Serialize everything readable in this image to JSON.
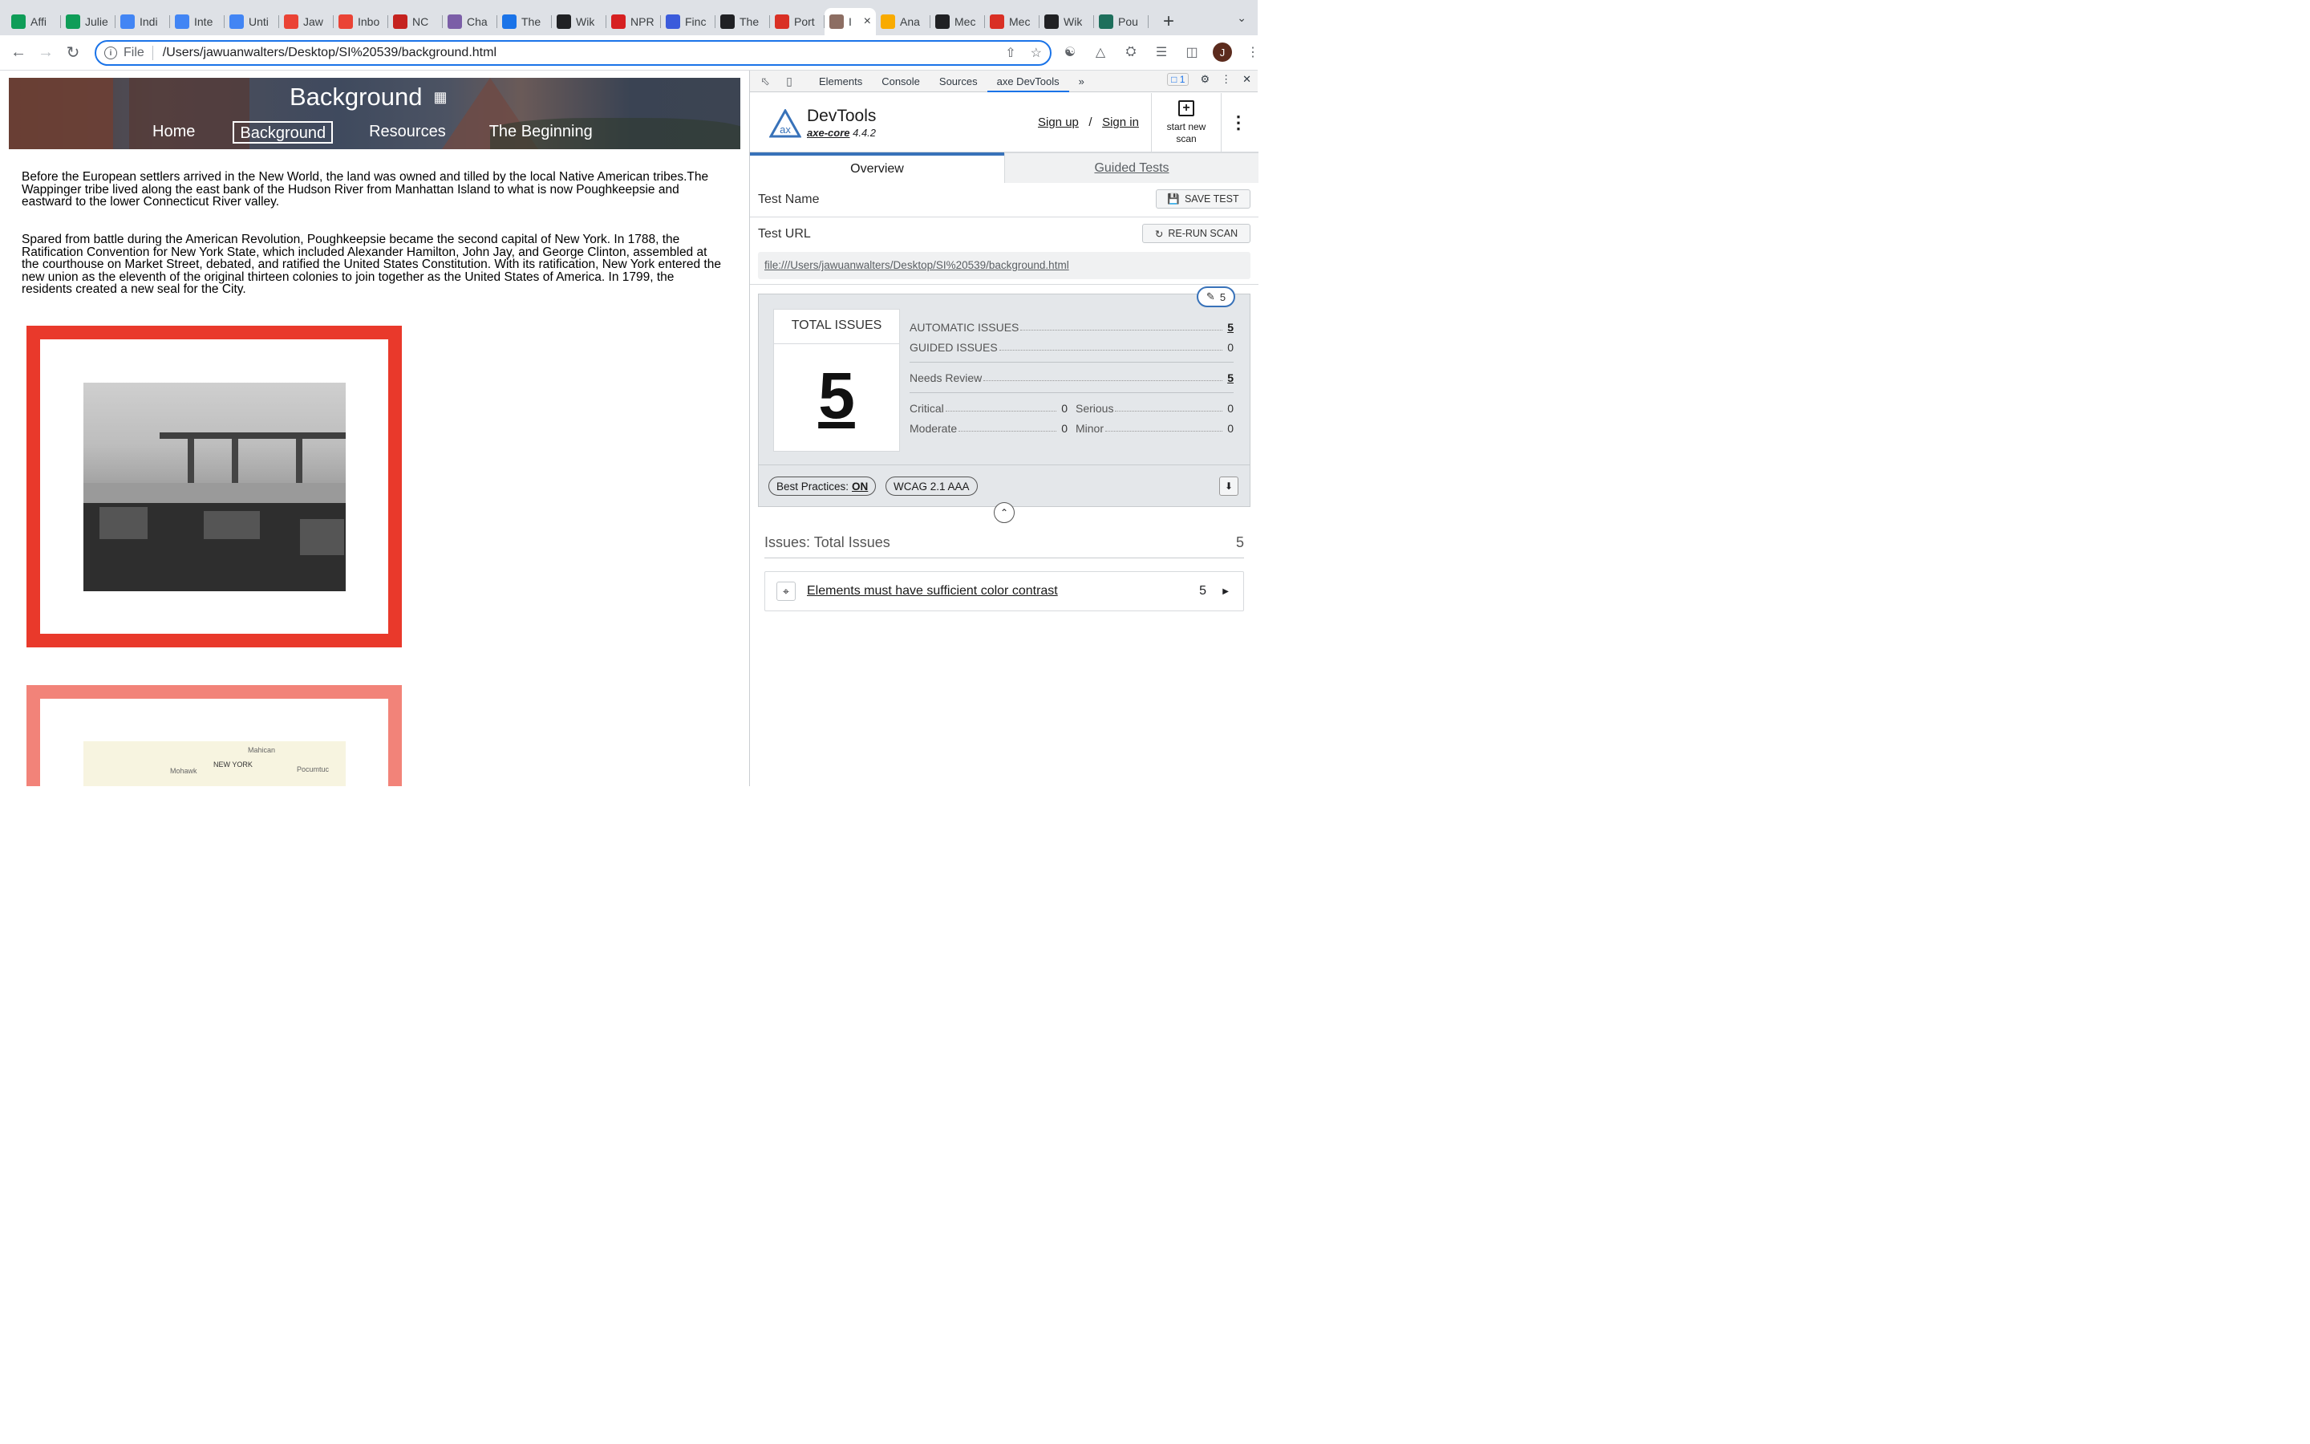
{
  "browser": {
    "tabs": [
      {
        "title": "Affi",
        "icon": "drive-icon",
        "color": "#0f9d58"
      },
      {
        "title": "Julie",
        "icon": "sheets-icon",
        "color": "#0f9d58"
      },
      {
        "title": "Indi",
        "icon": "docs-icon",
        "color": "#4285f4"
      },
      {
        "title": "Inte",
        "icon": "docs-icon",
        "color": "#4285f4"
      },
      {
        "title": "Unti",
        "icon": "docs-icon",
        "color": "#4285f4"
      },
      {
        "title": "Jaw",
        "icon": "gmail-icon",
        "color": "#ea4335"
      },
      {
        "title": "Inbo",
        "icon": "gmail-icon",
        "color": "#ea4335"
      },
      {
        "title": "NC",
        "icon": "nc-icon",
        "color": "#c5221f"
      },
      {
        "title": "Cha",
        "icon": "chart-icon",
        "color": "#7b5ea7"
      },
      {
        "title": "The",
        "icon": "hook-icon",
        "color": "#1a73e8"
      },
      {
        "title": "Wik",
        "icon": "wikipedia-icon",
        "color": "#202124"
      },
      {
        "title": "NPR",
        "icon": "npr-icon",
        "color": "#d62021"
      },
      {
        "title": "Finc",
        "icon": "find-icon",
        "color": "#3b5bdb"
      },
      {
        "title": "The",
        "icon": "nyt-icon",
        "color": "#202124"
      },
      {
        "title": "Port",
        "icon": "portal-icon",
        "color": "#d93025"
      },
      {
        "title": "I",
        "icon": "page-thumb-icon",
        "color": "#8d6e63",
        "active": true
      },
      {
        "title": "Ana",
        "icon": "analytics-icon",
        "color": "#f9ab00"
      },
      {
        "title": "Mec",
        "icon": "mec-icon",
        "color": "#202124"
      },
      {
        "title": "Mec",
        "icon": "asterisk-icon",
        "color": "#d93025"
      },
      {
        "title": "Wik",
        "icon": "wikipedia-icon",
        "color": "#202124"
      },
      {
        "title": "Pou",
        "icon": "lp-icon",
        "color": "#1e6f5c"
      }
    ],
    "new_tab": "+",
    "address": {
      "scheme_label": "File",
      "url": "/Users/jawuanwalters/Desktop/SI%20539/background.html"
    },
    "avatar_letter": "J"
  },
  "page": {
    "header_title": "Background",
    "nav": [
      "Home",
      "Background",
      "Resources",
      "The Beginning"
    ],
    "paragraph1": "Before the European settlers arrived in the New World, the land was owned and tilled by the local Native American tribes.The Wappinger tribe lived along the east bank of the Hudson River from Manhattan Island to what is now Poughkeepsie and eastward to the lower Connecticut River valley.",
    "paragraph2": "Spared from battle during the American Revolution, Poughkeepsie became the second capital of New York. In 1788, the Ratification Convention for New York State, which included Alexander Hamilton, John Jay, and George Clinton, assembled at the courthouse on Market Street, debated, and ratified the United States Constitution. With its ratification, New York entered the new union as the eleventh of the original thirteen colonies to join together as the United States of America. In 1799, the residents created a new seal for the City.",
    "map_labels": [
      "Mahican",
      "Mohawk",
      "NEW YORK",
      "Pocumtuc"
    ]
  },
  "devtools": {
    "tabs": [
      "Elements",
      "Console",
      "Sources",
      "axe DevTools"
    ],
    "active_tab": "axe DevTools",
    "message_count": "1",
    "axe": {
      "title": "DevTools",
      "core_name": "axe-core",
      "core_version": "4.4.2",
      "logo_text": "ax",
      "sign_up": "Sign up",
      "separator": "/",
      "sign_in": "Sign in",
      "start_new_scan": "start new scan",
      "tab_overview": "Overview",
      "tab_guided": "Guided Tests",
      "test_name_label": "Test Name",
      "save_test": "SAVE TEST",
      "test_url_label": "Test URL",
      "rerun_scan": "RE-RUN SCAN",
      "test_url": "file:///Users/jawuanwalters/Desktop/SI%20539/background.html",
      "edit_count": "5",
      "total_issues_label": "TOTAL ISSUES",
      "total_issues": "5",
      "automatic_label": "AUTOMATIC ISSUES",
      "automatic": "5",
      "guided_label": "GUIDED ISSUES",
      "guided": "0",
      "needs_review_label": "Needs Review",
      "needs_review": "5",
      "critical_label": "Critical",
      "critical": "0",
      "serious_label": "Serious",
      "serious": "0",
      "moderate_label": "Moderate",
      "moderate": "0",
      "minor_label": "Minor",
      "minor": "0",
      "best_practices_label": "Best Practices:",
      "best_practices_value": "ON",
      "standard": "WCAG 2.1 AAA",
      "issues_heading": "Issues: Total Issues",
      "issues_total": "5",
      "issue": {
        "label": "Elements must have sufficient color contrast",
        "count": "5"
      },
      "accent_color": "#3872b9"
    }
  }
}
